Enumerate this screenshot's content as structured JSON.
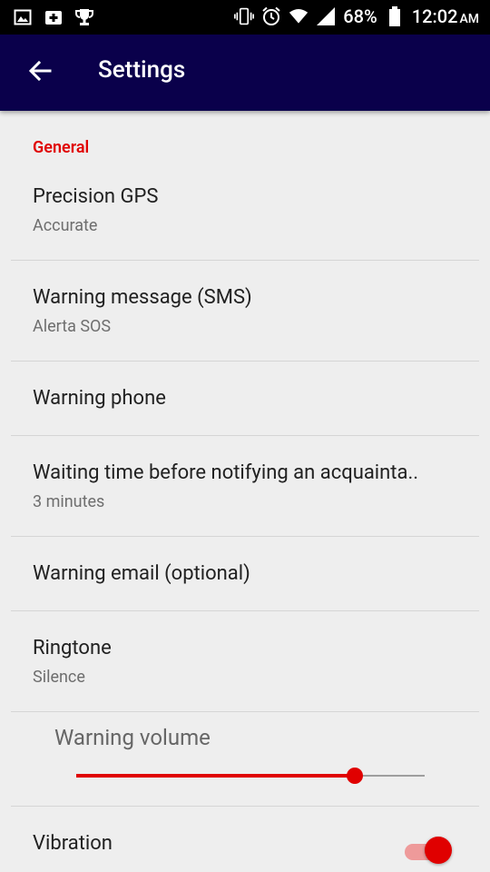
{
  "status_bar": {
    "battery": "68%",
    "time": "12:02",
    "ampm": "AM",
    "left_icons": [
      "image-icon",
      "health-plus-icon",
      "trophy-icon"
    ],
    "right_icons": [
      "vibrate-icon",
      "alarm-icon",
      "wifi-icon",
      "signal-icon",
      "battery-icon"
    ]
  },
  "toolbar": {
    "title": "Settings",
    "back_icon": "arrow-back-icon"
  },
  "section": {
    "header": "General"
  },
  "prefs": {
    "precision_gps": {
      "title": "Precision GPS",
      "summary": "Accurate"
    },
    "warning_sms": {
      "title": "Warning message (SMS)",
      "summary": "Alerta SOS"
    },
    "warning_phone": {
      "title": "Warning phone"
    },
    "waiting_time": {
      "title": "Waiting time before notifying an acquainta..",
      "summary": "3 minutes"
    },
    "warning_email": {
      "title": "Warning email (optional)"
    },
    "ringtone": {
      "title": "Ringtone",
      "summary": "Silence"
    },
    "warning_volume": {
      "title": "Warning volume",
      "value": 0.8
    },
    "vibration": {
      "title": "Vibration",
      "checked": true
    }
  },
  "colors": {
    "accent": "#e00000",
    "toolbar": "#0a004b",
    "status_bar": "#000000",
    "background": "#eeeeee"
  }
}
